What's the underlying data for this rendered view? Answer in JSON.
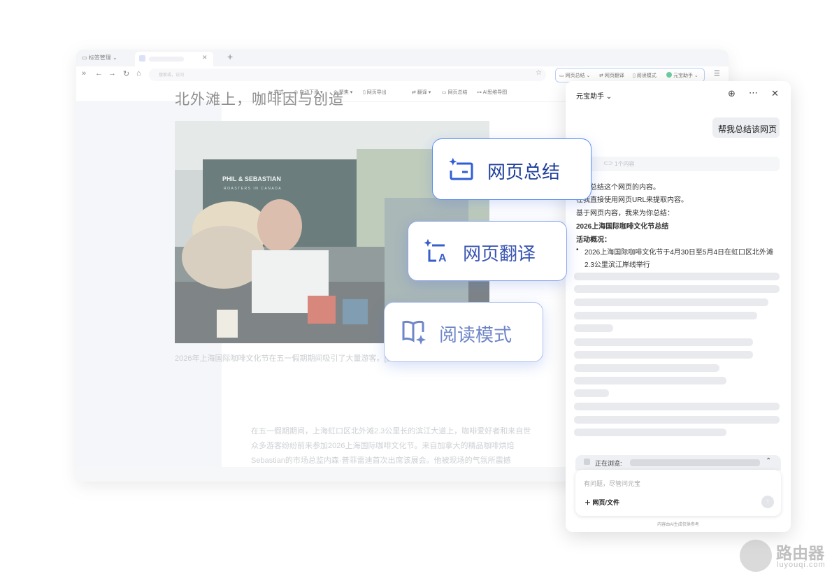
{
  "browser": {
    "tab_manager_label": "标签管理",
    "omnibox_placeholder": "搜索或，访问",
    "ai_tools": {
      "summary": "网页总结",
      "translate": "网页翻译",
      "reader": "阅读模式",
      "assistant": "元宝助手"
    },
    "toolbar": [
      "样式",
      "自动下滑",
      "聚焦",
      "网页导出",
      "翻译",
      "网页总结",
      "AI思维导图"
    ]
  },
  "article": {
    "title": "北外滩上，咖啡因与创造",
    "photo_sign_line1": "PHIL & SEBASTIAN",
    "photo_sign_line2": "ROASTERS IN CANADA",
    "caption": "2026年上海国际咖啡文化节在五一假期期间吸引了大量游客。[图片由《中国日报》提",
    "para_line1": "在五一假期期间，上海虹口区北外滩2.3公里长的滨江大道上，咖啡爱好者和来自世",
    "para_line2": "众多游客纷纷前来参加2026上海国际咖啡文化节。来自加拿大的精品咖啡烘焙",
    "para_line3": "Sebastian的市场总监内森·普菲雷迪首次出席该展会。他被现场的气氛所震撼"
  },
  "feature_cards": {
    "summary": "网页总结",
    "translate": "网页翻译",
    "reader": "阅读模式"
  },
  "panel": {
    "title": "元宝助手",
    "user_message": "帮我总结该网页",
    "ref_label": "1个内容",
    "answer_lines": [
      "帮你总结这个网页的内容。",
      "在我直接使用网页URL来提取内容。",
      "基于网页内容，我来为你总结："
    ],
    "answer_heading": "2026上海国际咖啡文化节总结",
    "section_label": "活动概况：",
    "bullet_line1": "2026上海国际咖啡文化节于4月30日至5月4日在虹口区北外滩",
    "bullet_line2": "2.3公里滨江岸线举行",
    "browsing_label": "正在浏览:",
    "input_placeholder": "有问题，尽管问元宝",
    "attach_label": "网页/文件",
    "disclaimer": "内容由AI生成仅供参考"
  },
  "watermark": {
    "text": "路由器",
    "url": "luyouqi.com"
  },
  "colors": {
    "accent": "#3b6fe0",
    "card_text": "#1f3f9a",
    "panel_bg": "#ffffff"
  }
}
